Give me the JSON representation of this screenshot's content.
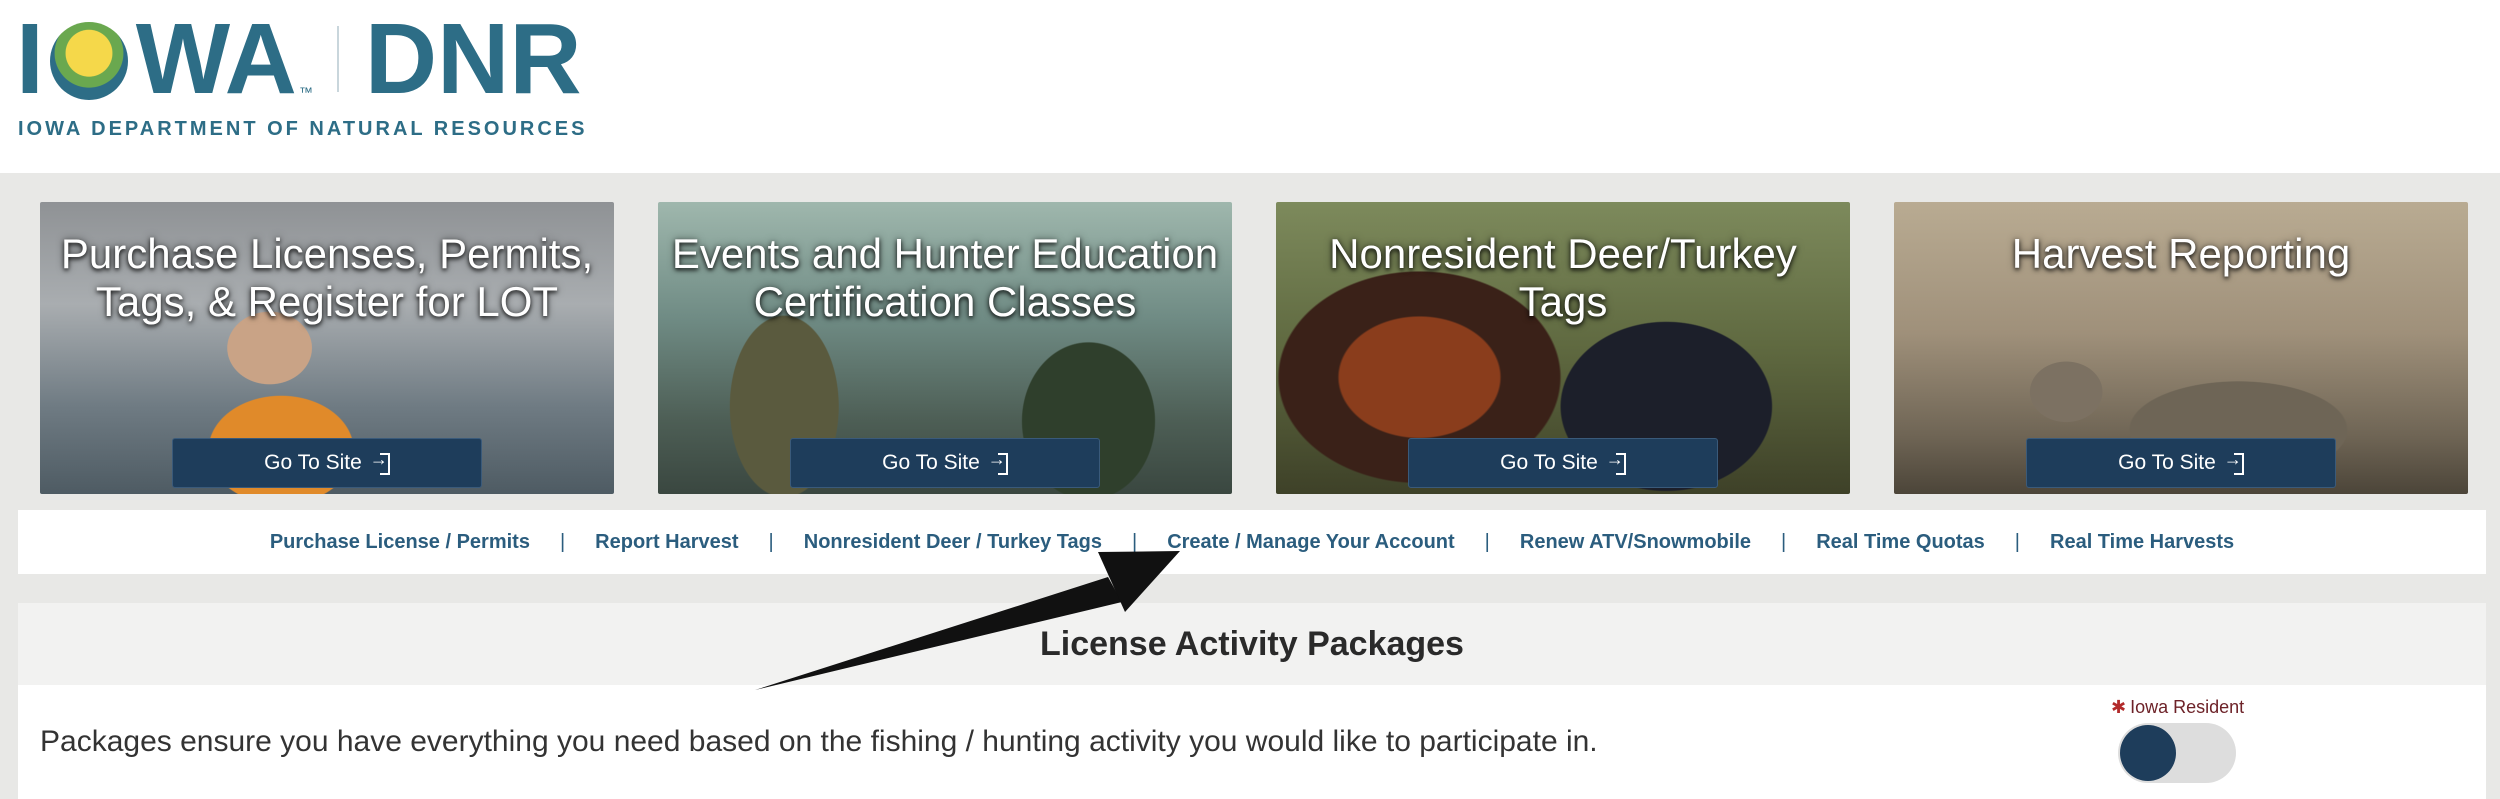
{
  "logo": {
    "wordmark_left": [
      "I",
      "WA"
    ],
    "trademark": "™",
    "wordmark_right": "DNR",
    "subtitle": "IOWA DEPARTMENT OF NATURAL RESOURCES"
  },
  "cards": [
    {
      "title": "Purchase Licenses, Permits, Tags, & Register for LOT",
      "button": "Go To Site",
      "button_icon": "external-link-icon"
    },
    {
      "title": "Events and Hunter Education Certification Classes",
      "button": "Go To Site",
      "button_icon": "external-link-icon"
    },
    {
      "title": "Nonresident Deer/Turkey Tags",
      "button": "Go To Site",
      "button_icon": "external-link-icon"
    },
    {
      "title": "Harvest Reporting",
      "button": "Go To Site",
      "button_icon": "external-link-icon"
    }
  ],
  "nav": {
    "separator": "|",
    "links": [
      "Purchase License / Permits",
      "Report Harvest",
      "Nonresident Deer / Turkey Tags",
      "Create / Manage Your Account",
      "Renew ATV/Snowmobile",
      "Real Time Quotas",
      "Real Time Harvests"
    ]
  },
  "packages": {
    "title": "License Activity Packages",
    "description": "Packages ensure you have everything you need based on the fishing / hunting activity you would like to participate in.",
    "resident_required_mark": "✱",
    "resident_label": "Iowa Resident",
    "resident_toggle_on": false
  },
  "colors": {
    "brand_teal": "#2d6d86",
    "button_navy": "#1e3d5b",
    "link_blue": "#2b5d7e",
    "required_red": "#b22a2a"
  }
}
